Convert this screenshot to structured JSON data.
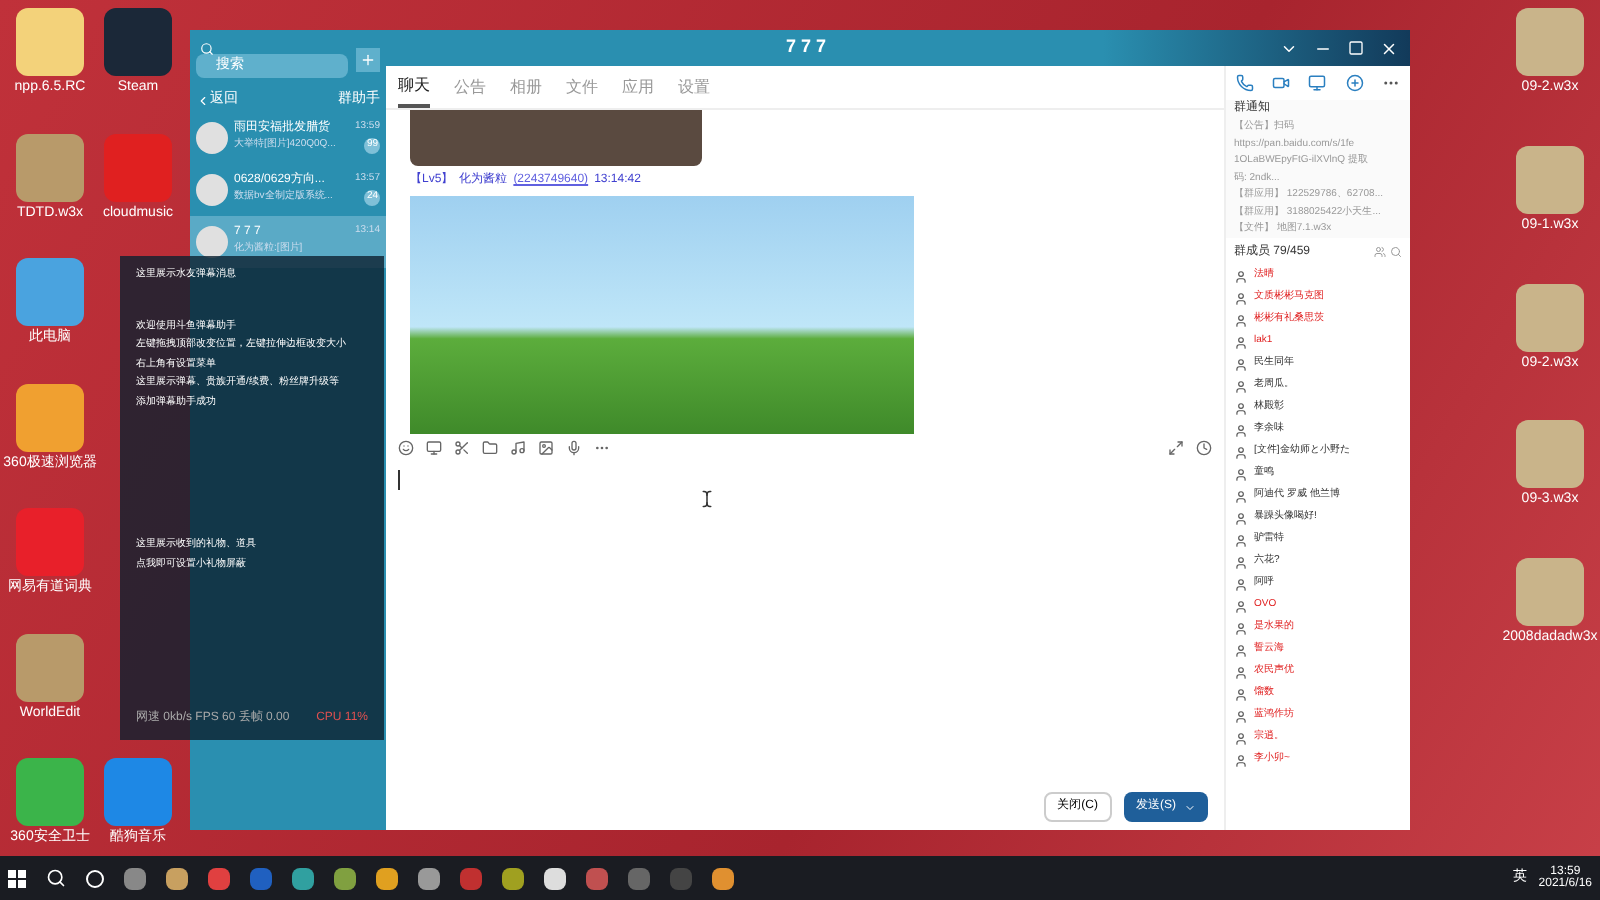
{
  "desktop_left": [
    {
      "label": "npp.6.5.RC",
      "color": "#f3d27a"
    },
    {
      "label": "TDTD.w3x",
      "color": "#b89a6a"
    },
    {
      "label": "此电脑",
      "color": "#4aa3df"
    },
    {
      "label": "360极速浏览器",
      "color": "#f0a030"
    },
    {
      "label": "网易有道词典",
      "color": "#e8202a"
    },
    {
      "label": "WorldEdit",
      "color": "#b89a6a"
    },
    {
      "label": "360安全卫士",
      "color": "#3bb44a"
    }
  ],
  "desktop_second": [
    {
      "label": "Steam",
      "color": "#1b2838"
    },
    {
      "label": "cloudmusic",
      "color": "#e02020"
    },
    {
      "label": "酷狗音乐",
      "color": "#1e88e5"
    }
  ],
  "desktop_right": [
    {
      "label": "09-2.w3x"
    },
    {
      "label": "09-1.w3x"
    },
    {
      "label": "09-2.w3x"
    },
    {
      "label": "09-3.w3x"
    },
    {
      "label": "2008dadadw3x"
    }
  ],
  "chat_list": {
    "search": {
      "placeholder": "搜索"
    },
    "back": "返回",
    "helper": "群助手",
    "items": [
      {
        "name": "雨田安福批发腊货",
        "time": "13:59",
        "preview": "大举特[图片]420Q0Q...",
        "badge": "99",
        "selected": false
      },
      {
        "name": "0628/0629方向...",
        "time": "13:57",
        "preview": "数据bv全制定版系统...",
        "badge": "24",
        "selected": false
      },
      {
        "name": "7 7 7",
        "time": "13:14",
        "preview": "化为酱粒:[图片]",
        "selected": true
      }
    ]
  },
  "overlay": {
    "top": "这里展示水友弹幕消息",
    "lines": [
      "欢迎使用斗鱼弹幕助手",
      "左键拖拽顶部改变位置，左键拉伸边框改变大小",
      "右上角有设置菜单",
      "这里展示弹幕、贵族开通/续费、粉丝牌升级等",
      "添加弹幕助手成功"
    ],
    "gifts": [
      "这里展示收到的礼物、道具",
      "点我即可设置小礼物屏蔽"
    ],
    "stats": "网速 0kb/s FPS 60 丢帧 0.00",
    "cpu": "CPU 11%"
  },
  "chat": {
    "title": "7 7 7",
    "tabs": [
      {
        "label": "聊天",
        "selected": true
      },
      {
        "label": "公告",
        "selected": false
      },
      {
        "label": "相册",
        "selected": false
      },
      {
        "label": "文件",
        "selected": false
      },
      {
        "label": "应用",
        "selected": false
      },
      {
        "label": "设置",
        "selected": false
      }
    ],
    "sender": {
      "level": "【Lv5】",
      "name": "化为酱粒",
      "id": "(2243749640)",
      "time": "13:14:42"
    },
    "notice": {
      "title": "群通知",
      "lines": [
        "【公告】扫码",
        "https://pan.baidu.com/s/1fe",
        "1OLaBWEpyFtG-ilXVlnQ 提取",
        "码: 2ndk...",
        "【群应用】 122529786、62708...",
        "【群应用】 3188025422小天生...",
        "【文件】 地图7.1.w3x"
      ]
    },
    "members_title": "群成员 79/459",
    "members": [
      {
        "name": "法晴",
        "vip": true
      },
      {
        "name": "文质彬彬马克图",
        "vip": true
      },
      {
        "name": "彬彬有礼桑思茨",
        "vip": true
      },
      {
        "name": "lak1",
        "vip": true
      },
      {
        "name": "民生同年",
        "vip": false
      },
      {
        "name": "老周瓜。",
        "vip": false
      },
      {
        "name": "林殿彰",
        "vip": false
      },
      {
        "name": "李余味",
        "vip": false
      },
      {
        "name": "[文件]金幼师と小野た",
        "vip": false
      },
      {
        "name": "童鸣",
        "vip": false
      },
      {
        "name": "阿迪代 罗威 他兰博",
        "vip": false
      },
      {
        "name": "暴躁头像喝好!",
        "vip": false
      },
      {
        "name": "驴雷特",
        "vip": false
      },
      {
        "name": "六花?",
        "vip": false
      },
      {
        "name": "阿呼",
        "vip": false
      },
      {
        "name": "OVO",
        "vip": true
      },
      {
        "name": "是水果的",
        "vip": true
      },
      {
        "name": "誓云海",
        "vip": true
      },
      {
        "name": "农民声优",
        "vip": true
      },
      {
        "name": "馏数",
        "vip": true
      },
      {
        "name": "蓝鸿作坊",
        "vip": true
      },
      {
        "name": "宗逍。",
        "vip": true
      },
      {
        "name": "李小卯~",
        "vip": true
      }
    ],
    "close": "关闭(C)",
    "send": "发送(S)"
  },
  "taskbar": {
    "time": "13:59",
    "date": "2021/6/16",
    "ime": "英"
  }
}
